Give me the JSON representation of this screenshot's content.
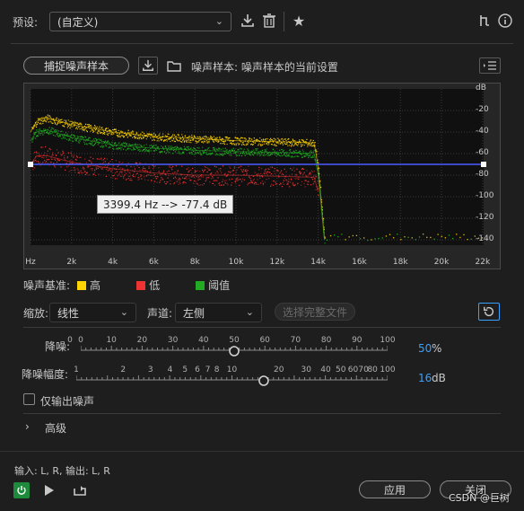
{
  "preset": {
    "label": "预设:",
    "value": "(自定义)"
  },
  "capture": {
    "button": "捕捉噪声样本",
    "noise_sample_text": "噪声样本: 噪声样本的当前设置"
  },
  "chart_data": {
    "type": "line",
    "x_ticks": [
      "Hz",
      "2k",
      "4k",
      "6k",
      "8k",
      "10k",
      "12k",
      "14k",
      "16k",
      "18k",
      "20k",
      "22k"
    ],
    "y_ticks": [
      "dB",
      "-20",
      "-40",
      "-60",
      "-80",
      "-100",
      "-120",
      "-140"
    ],
    "xlim": [
      0,
      22050
    ],
    "ylim": [
      -145,
      0
    ],
    "tooltip": "3399.4 Hz --> -77.4 dB",
    "threshold_db": -70,
    "series": [
      {
        "name": "高",
        "color": "#ffd400",
        "x": [
          0,
          300,
          800,
          2000,
          4000,
          6000,
          8000,
          10000,
          12000,
          13800,
          14000,
          14300
        ],
        "y": [
          -40,
          -30,
          -27,
          -33,
          -40,
          -44,
          -46,
          -48,
          -49,
          -50,
          -72,
          -138
        ]
      },
      {
        "name": "阈值",
        "color": "#22aa22",
        "x": [
          0,
          300,
          800,
          2000,
          4000,
          6000,
          8000,
          10000,
          12000,
          13800,
          14000,
          14300
        ],
        "y": [
          -48,
          -40,
          -38,
          -45,
          -52,
          -55,
          -57,
          -58,
          -59,
          -60,
          -80,
          -140
        ]
      },
      {
        "name": "低",
        "color": "#ee3333",
        "x": [
          0,
          300,
          800,
          2000,
          4000,
          6000,
          8000,
          10000,
          12000,
          13800,
          14000
        ],
        "y": [
          -70,
          -62,
          -62,
          -68,
          -74,
          -78,
          -80,
          -80,
          -81,
          -82,
          -95
        ]
      }
    ]
  },
  "legend": {
    "label": "噪声基准:",
    "items": [
      "高",
      "低",
      "阈值"
    ],
    "colors": [
      "#ffd400",
      "#ee3333",
      "#22aa22"
    ]
  },
  "scale": {
    "label": "缩放:",
    "value": "线性"
  },
  "channel": {
    "label": "声道:",
    "value": "左侧"
  },
  "select_file_button": "选择完整文件",
  "reduction": {
    "label": "降噪:",
    "ticks": [
      "0",
      "10",
      "20",
      "30",
      "40",
      "50",
      "60",
      "70",
      "80",
      "90",
      "100"
    ],
    "zero_label": "0",
    "value_percent": 50,
    "value": "50",
    "unit": "%"
  },
  "reduce_by": {
    "label": "降噪幅度:",
    "ticks": [
      "1",
      "2",
      "3",
      "4",
      "5",
      "6",
      "7",
      "8",
      "10",
      "20",
      "30",
      "40",
      "50",
      "60",
      "70",
      "80",
      "100"
    ],
    "value_db": 16,
    "value": "16",
    "unit": "dB"
  },
  "output_noise_only": "仅输出噪声",
  "advanced": "高级",
  "io_text": "输入: L, R, 输出: L, R",
  "apply_button": "应用",
  "close_button": "关闭",
  "watermark": "CSDN @巨树"
}
